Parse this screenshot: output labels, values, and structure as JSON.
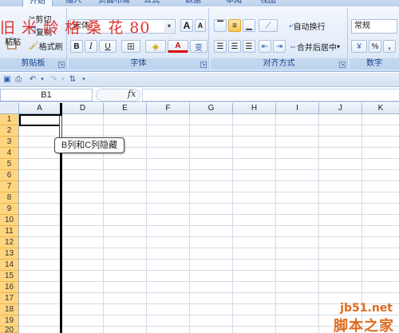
{
  "tabs": [
    {
      "label": "开始",
      "active": true
    },
    {
      "label": "插入",
      "active": false
    },
    {
      "label": "页面布局",
      "active": false
    },
    {
      "label": "公式",
      "active": false
    },
    {
      "label": "数据",
      "active": false
    },
    {
      "label": "审阅",
      "active": false
    },
    {
      "label": "视图",
      "active": false
    }
  ],
  "overlay_title": "旧 米 龄 格 桑 花 80",
  "clipboard": {
    "paste": "粘贴",
    "cut": "剪切",
    "copy": "复制",
    "format_painter": "格式刷",
    "label": "剪贴板"
  },
  "font": {
    "name": "宋体",
    "grow": "A",
    "shrink": "A",
    "bold": "B",
    "italic": "I",
    "underline": "U",
    "font_color": "A",
    "phonetic": "变",
    "label": "字体"
  },
  "alignment": {
    "wrap": "自动换行",
    "merge": "合并后居中",
    "label": "对齐方式"
  },
  "number": {
    "format": "常规",
    "percent": "%",
    "comma": ",",
    "label": "数字"
  },
  "name_box": "B1",
  "fx": "fx",
  "columns": [
    "A",
    "D",
    "E",
    "F",
    "G",
    "H",
    "I",
    "J",
    "K"
  ],
  "rows": [
    "1",
    "2",
    "3",
    "4",
    "5",
    "6",
    "7",
    "8",
    "9",
    "10",
    "11",
    "12",
    "13",
    "14",
    "15",
    "16",
    "17",
    "18",
    "19",
    "20"
  ],
  "callout": "B列和C列隐藏",
  "watermark": {
    "site": "jb51.net",
    "name": "脚本之家"
  },
  "colors": {
    "accent": "#15428b",
    "row_header": "#ffd580",
    "ribbon": "#dfe9f6"
  }
}
